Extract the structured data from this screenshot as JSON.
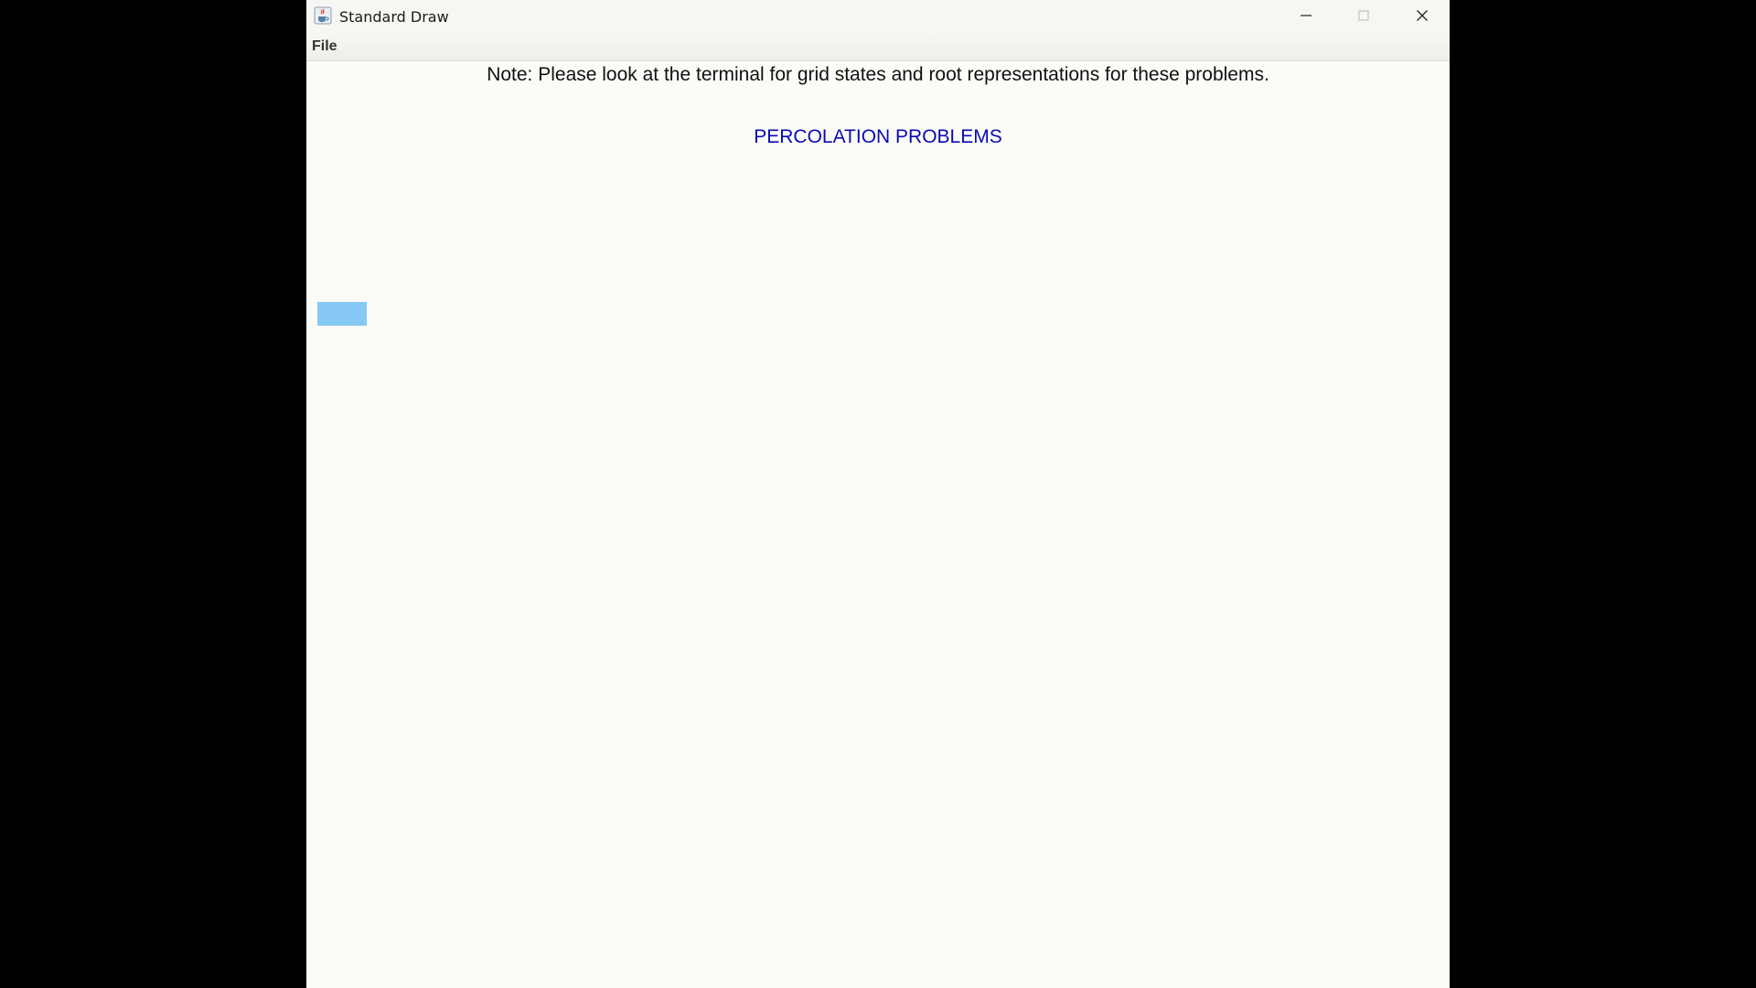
{
  "window": {
    "title": "Standard Draw"
  },
  "menubar": {
    "file_label": "File"
  },
  "canvas": {
    "note": "Note: Please look at the terminal for grid states and root representations for these problems.",
    "heading": "PERCOLATION PROBLEMS",
    "heading_color": "#0b0bb0",
    "cell_color": "#86c8f4"
  },
  "icons": {
    "app": "java-cup-icon",
    "minimize": "minimize-icon",
    "maximize": "maximize-icon",
    "close": "close-icon"
  }
}
